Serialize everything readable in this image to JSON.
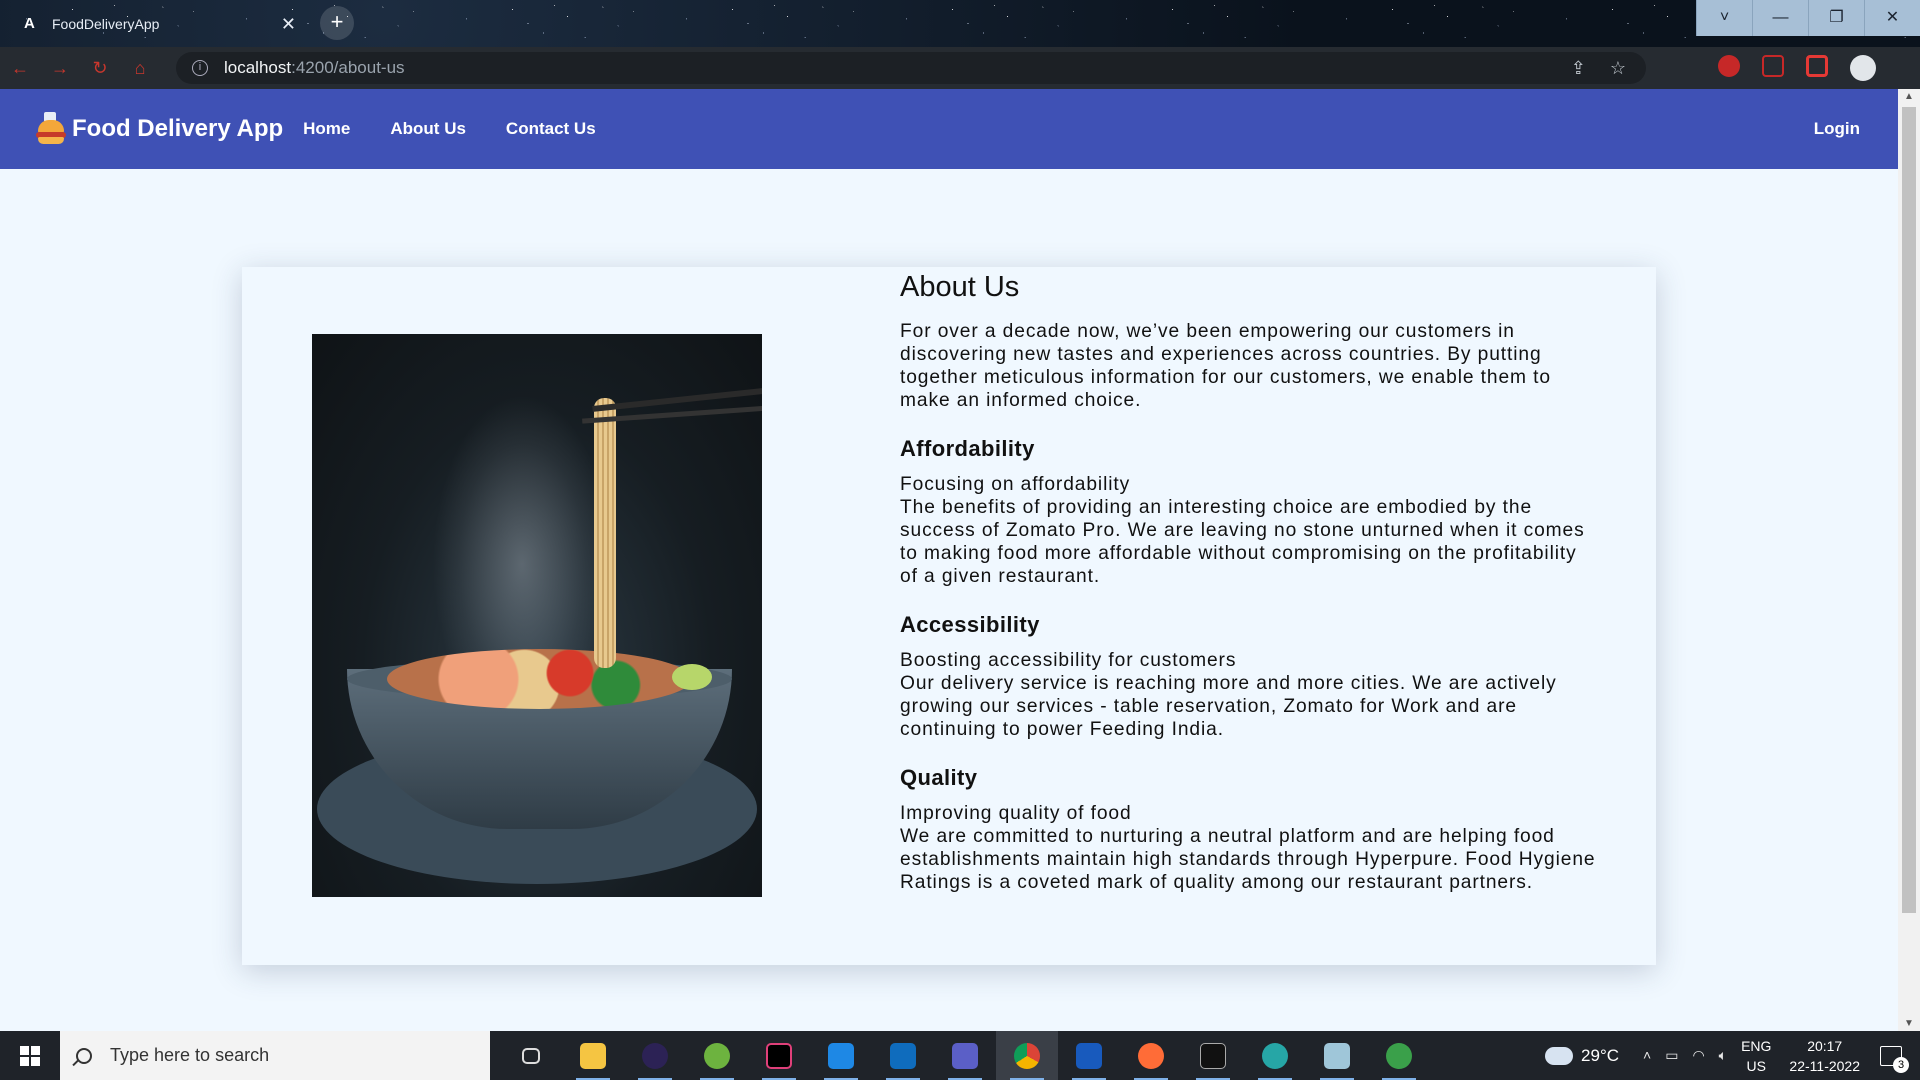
{
  "browser": {
    "tab_title": "FoodDeliveryApp",
    "tab_icon": "angular-icon",
    "url_host": "localhost",
    "url_path": ":4200/about-us",
    "window_controls": [
      "˅",
      "—",
      "❐",
      "✕"
    ]
  },
  "navbar": {
    "brand": "Food Delivery App",
    "links": [
      "Home",
      "About Us",
      "Contact Us"
    ],
    "login": "Login",
    "color": "#3f51b5"
  },
  "about": {
    "title": "About Us",
    "intro": "For over a decade now, we’ve been empowering our customers in discovering new tastes and experiences across countries. By putting together meticulous information for our customers, we enable them to make an informed choice.",
    "sections": [
      {
        "heading": "Affordability",
        "subtitle": "Focusing on affordability",
        "body": "The benefits of providing an interesting choice are embodied by the success of Zomato Pro. We are leaving no stone unturned when it comes to making food more affordable without compromising on the profitability of a given restaurant."
      },
      {
        "heading": "Accessibility",
        "subtitle": "Boosting accessibility for customers",
        "body": "Our delivery service is reaching more and more cities. We are actively growing our services - table reservation, Zomato for Work and are continuing to power Feeding India."
      },
      {
        "heading": "Quality",
        "subtitle": "Improving quality of food",
        "body": "We are committed to nurturing a neutral platform and are helping food establishments maintain high standards through Hyperpure. Food Hygiene Ratings is a coveted mark of quality among our restaurant partners."
      }
    ]
  },
  "taskbar": {
    "search_placeholder": "Type here to search",
    "temperature": "29°C",
    "lang": "ENG",
    "region": "US",
    "time": "20:17",
    "date": "22-11-2022",
    "notifications": "3"
  }
}
